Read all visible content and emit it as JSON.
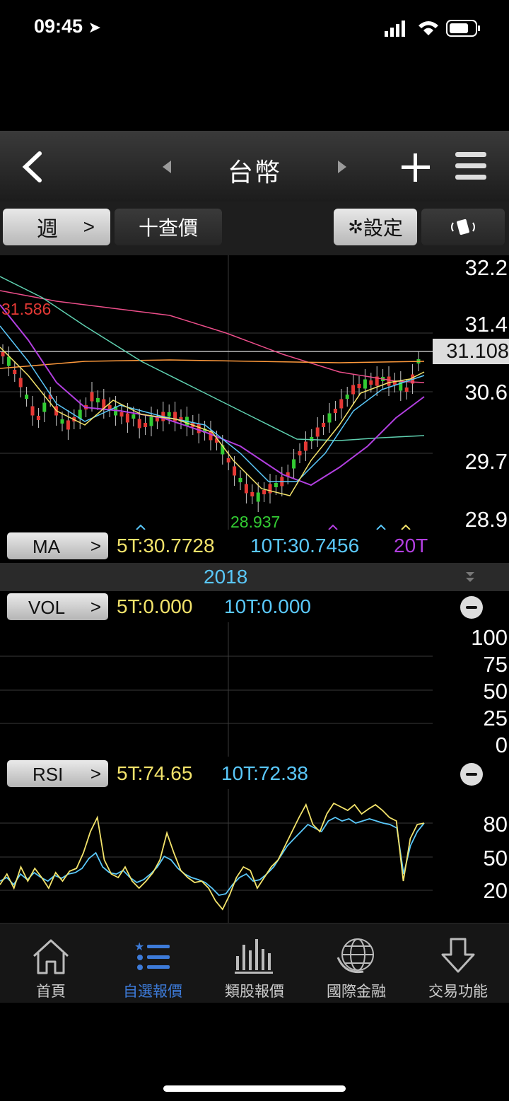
{
  "status": {
    "time": "09:45"
  },
  "nav": {
    "title": "台幣"
  },
  "toolbar": {
    "period": "週",
    "period_arrow": ">",
    "query": "十查價",
    "settings": "設定"
  },
  "main_chart": {
    "y_ticks": [
      "32.2",
      "31.4",
      "30.6",
      "29.7",
      "28.9"
    ],
    "current_price": "31.108",
    "high_label": "31.586",
    "low_label": "28.937"
  },
  "ma_row": {
    "label": "MA",
    "arrow": ">",
    "ma5": "5T:30.7728",
    "ma10": "10T:30.7456",
    "ma20": "20T"
  },
  "year_label": "2018",
  "vol_row": {
    "label": "VOL",
    "arrow": ">",
    "v5": "5T:0.000",
    "v10": "10T:0.000",
    "ticks": [
      "100",
      "75",
      "50",
      "25",
      "0"
    ]
  },
  "rsi_row": {
    "label": "RSI",
    "arrow": ">",
    "r5": "5T:74.65",
    "r10": "10T:72.38",
    "ticks": [
      "80",
      "50",
      "20"
    ]
  },
  "tabs": [
    {
      "label": "首頁",
      "icon": "home-icon"
    },
    {
      "label": "自選報價",
      "icon": "list-icon"
    },
    {
      "label": "類股報價",
      "icon": "bars-icon"
    },
    {
      "label": "國際金融",
      "icon": "globe-icon"
    },
    {
      "label": "交易功能",
      "icon": "trade-icon"
    }
  ],
  "colors": {
    "up": "#e53935",
    "down": "#33cc33",
    "ma5": "#f3e36b",
    "ma10": "#5ac8fa",
    "ma20": "#b23fe0",
    "active_tab": "#3d7bd9"
  }
}
